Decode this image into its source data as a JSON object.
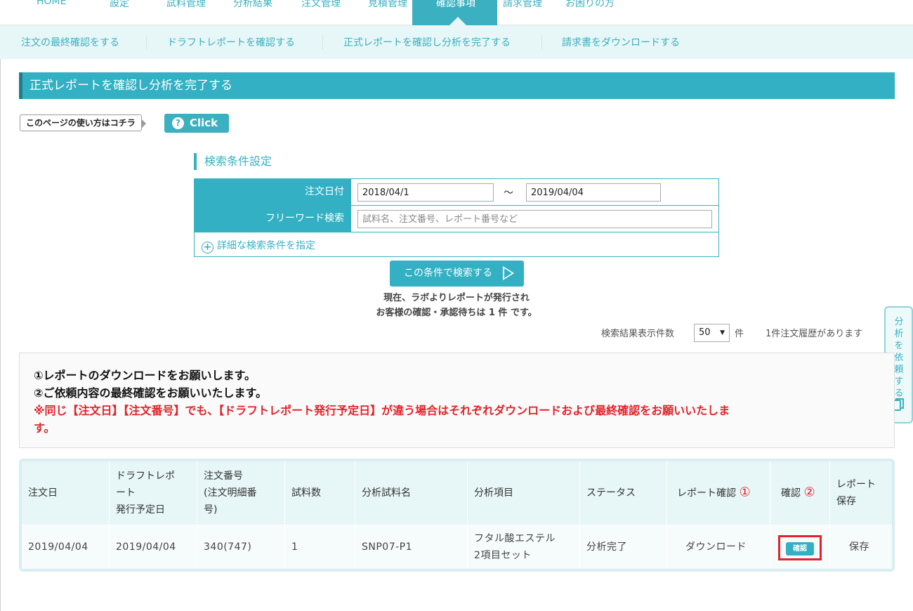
{
  "top_nav": {
    "items": [
      "HOME",
      "設定",
      "試料管理",
      "分析結果",
      "注文管理",
      "見積管理",
      "確認事項",
      "請求管理",
      "お困りの方"
    ],
    "active_index": 6
  },
  "sub_nav": {
    "items": [
      "注文の最終確認をする",
      "ドラフトレポートを確認する",
      "正式レポートを確認し分析を完了する",
      "請求書をダウンロードする"
    ]
  },
  "page_title": "正式レポートを確認し分析を完了する",
  "howto": {
    "label": "このページの使い方はコチラ",
    "button": "Click",
    "icon": "question-icon"
  },
  "search": {
    "heading": "検索条件設定",
    "order_date_label": "注文日付",
    "date_from": "2018/04/1",
    "date_tilde": "〜",
    "date_to": "2019/04/04",
    "freeword_label": "フリーワード検索",
    "freeword_placeholder": "試料名、注文番号、レポート番号など",
    "detail_link": "詳細な検索条件を指定",
    "submit": "この条件で検索する"
  },
  "pending": {
    "line1": "現在、ラボよりレポートが発行され",
    "line2": "お客様の確認・承認待ちは 1 件 です。"
  },
  "results": {
    "count_label": "検索結果表示件数",
    "count_value": "50",
    "unit": "件",
    "history": "1件注文履歴があります"
  },
  "side_tab": {
    "label": "分析を依頼する",
    "icon": "copy-icon"
  },
  "notice": {
    "line1": "①レポートのダウンロードをお願いします。",
    "line2": "②ご依頼内容の最終確認をお願いいたします。",
    "warning_line1": "※同じ【注文日】【注文番号】でも、【ドラフトレポート発行予定日】が違う場合はそれぞれダウンロードおよび最終確認をお願いいたしま",
    "warning_line2": "す。"
  },
  "table": {
    "headers": {
      "order_date": "注文日",
      "draft_1": "ドラフトレポ",
      "draft_2": "ート",
      "draft_3": "発行予定日",
      "order_no_1": "注文番号",
      "order_no_2": "(注文明細番",
      "order_no_3": "号)",
      "sample_count": "試料数",
      "sample_name": "分析試料名",
      "analysis_item": "分析項目",
      "status": "ステータス",
      "report_confirm": "レポート確認",
      "report_confirm_num": "①",
      "confirm": "確認",
      "confirm_num": "②",
      "report_save_1": "レポート",
      "report_save_2": "保存"
    },
    "rows": [
      {
        "order_date": "2019/04/04",
        "draft_date": "2019/04/04",
        "order_no": "340(747)",
        "sample_count": "1",
        "sample_name": "SNP07-P1",
        "analysis_item_1": "フタル酸エステル",
        "analysis_item_2": "2項目セット",
        "status": "分析完了",
        "download": "ダウンロード",
        "confirm_button": "確認",
        "save": "保存"
      }
    ]
  },
  "colors": {
    "accent": "#33b0c3",
    "accent_light": "#e7f6f7",
    "alert": "#e2232a"
  }
}
